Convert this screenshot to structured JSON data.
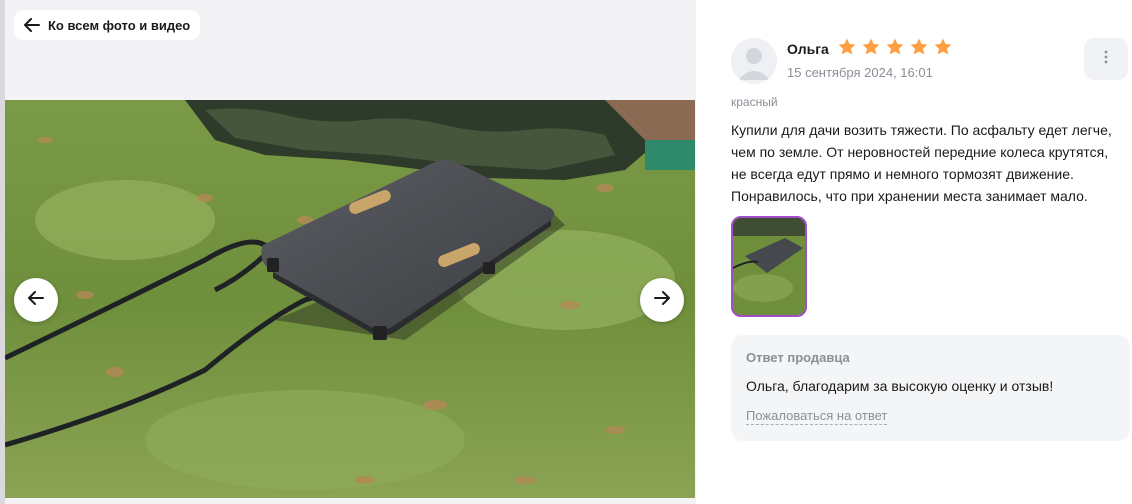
{
  "header": {
    "back_label": "Ко всем фото и видео",
    "back_icon": "arrow-left-icon"
  },
  "gallery": {
    "prev_icon": "arrow-left-icon",
    "next_icon": "arrow-right-icon"
  },
  "review": {
    "author": "Ольга",
    "rating": 5,
    "rating_max": 5,
    "date": "15 сентября 2024, 16:01",
    "variant": "красный",
    "text_lines": [
      "Купили для дачи возить тяжести. По асфальту едет легче,",
      "чем по земле. От неровностей передние колеса крутятся,",
      "не всегда едут прямо и немного тормозят движение.",
      "Понравилось, что при хранении места занимает мало."
    ],
    "more_icon": "more-vertical-icon"
  },
  "seller": {
    "title": "Ответ продавца",
    "reply": "Ольга, благодарим за высокую оценку и отзыв!",
    "complain_label": "Пожаловаться на ответ"
  },
  "colors": {
    "star": "#ff9f43",
    "thumb_border": "#a24dc9",
    "muted_text": "#8a8f98",
    "panel_bg": "#f4f5f7"
  }
}
